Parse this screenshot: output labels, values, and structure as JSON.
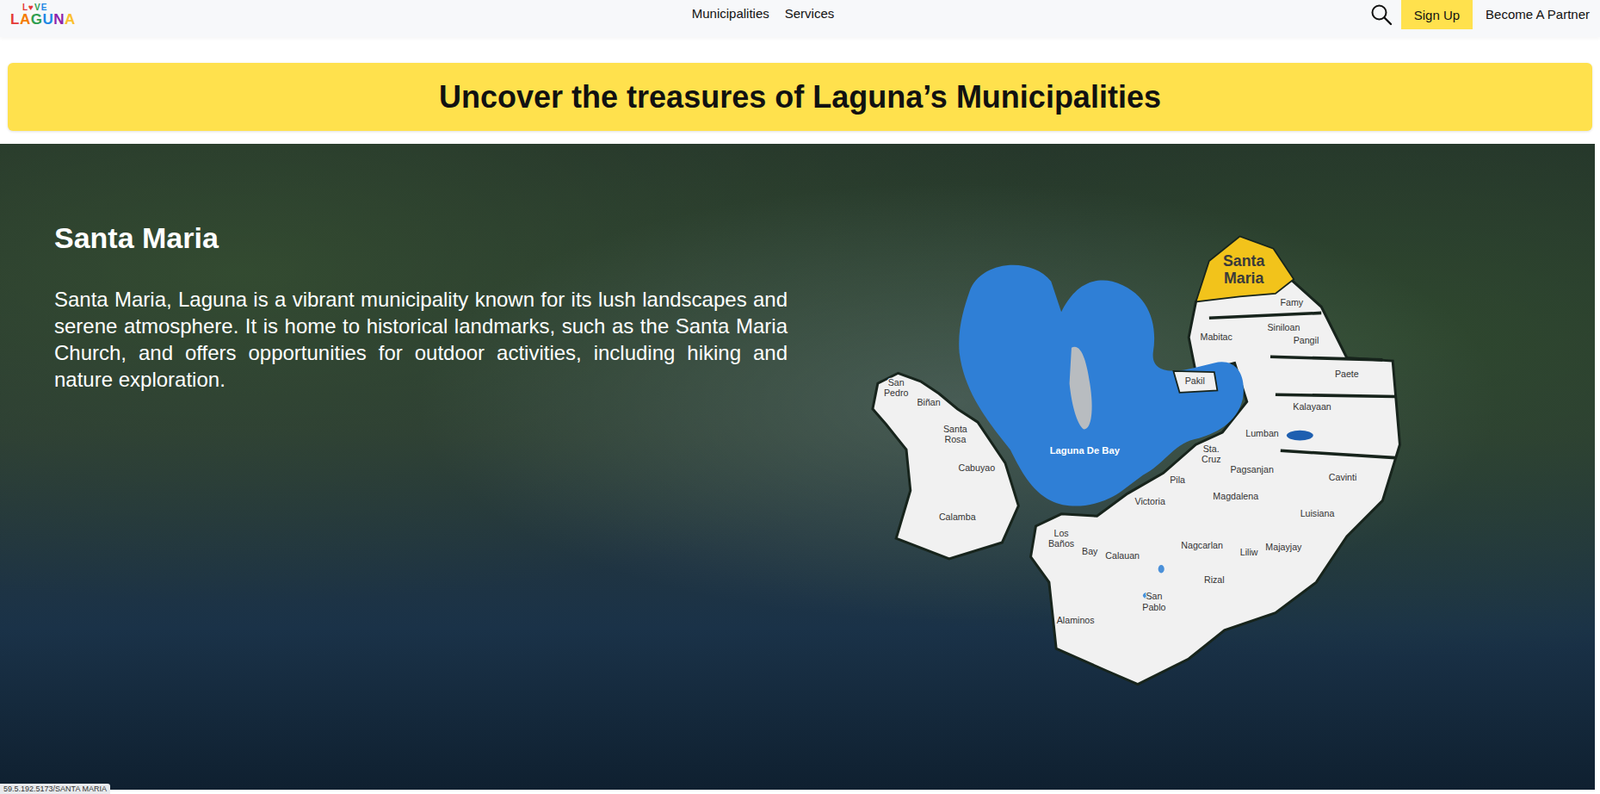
{
  "nav": {
    "logo": {
      "top": "L♥VE",
      "bottom": "LAGUNA"
    },
    "links": [
      "Municipalities",
      "Services"
    ],
    "sign_up": "Sign Up",
    "partner": "Become A Partner"
  },
  "banner": {
    "title": "Uncover the treasures of Laguna’s Municipalities"
  },
  "hero": {
    "title": "Santa Maria",
    "description": "Santa Maria, Laguna is a vibrant municipality known for its lush landscapes and serene atmosphere. It is home to historical landmarks, such as the Santa Maria Church, and offers opportunities for outdoor activities, including hiking and nature exploration."
  },
  "map": {
    "lake": "Laguna De Bay",
    "municipalities": [
      {
        "name": "San Pedro",
        "selected": false
      },
      {
        "name": "Biñan",
        "selected": false
      },
      {
        "name": "Santa Rosa",
        "selected": false
      },
      {
        "name": "Cabuyao",
        "selected": false
      },
      {
        "name": "Calamba",
        "selected": false
      },
      {
        "name": "Los Baños",
        "selected": false
      },
      {
        "name": "Bay",
        "selected": false
      },
      {
        "name": "Calauan",
        "selected": false
      },
      {
        "name": "Alaminos",
        "selected": false
      },
      {
        "name": "San Pablo",
        "selected": false
      },
      {
        "name": "Victoria",
        "selected": false
      },
      {
        "name": "Pila",
        "selected": false
      },
      {
        "name": "Sta. Cruz",
        "selected": false
      },
      {
        "name": "Nagcarlan",
        "selected": false
      },
      {
        "name": "Rizal",
        "selected": false
      },
      {
        "name": "Liliw",
        "selected": false
      },
      {
        "name": "Magdalena",
        "selected": false
      },
      {
        "name": "Pagsanjan",
        "selected": false
      },
      {
        "name": "Majayjay",
        "selected": false
      },
      {
        "name": "Luisiana",
        "selected": false
      },
      {
        "name": "Cavinti",
        "selected": false
      },
      {
        "name": "Lumban",
        "selected": false
      },
      {
        "name": "Kalayaan",
        "selected": false
      },
      {
        "name": "Paete",
        "selected": false
      },
      {
        "name": "Pakil",
        "selected": false
      },
      {
        "name": "Pangil",
        "selected": false
      },
      {
        "name": "Siniloan",
        "selected": false
      },
      {
        "name": "Famy",
        "selected": false
      },
      {
        "name": "Mabitac",
        "selected": false
      },
      {
        "name": "Santa Maria",
        "selected": true
      }
    ]
  },
  "status_bar": {
    "url": "59.5.192.5173/SANTA MARIA"
  }
}
